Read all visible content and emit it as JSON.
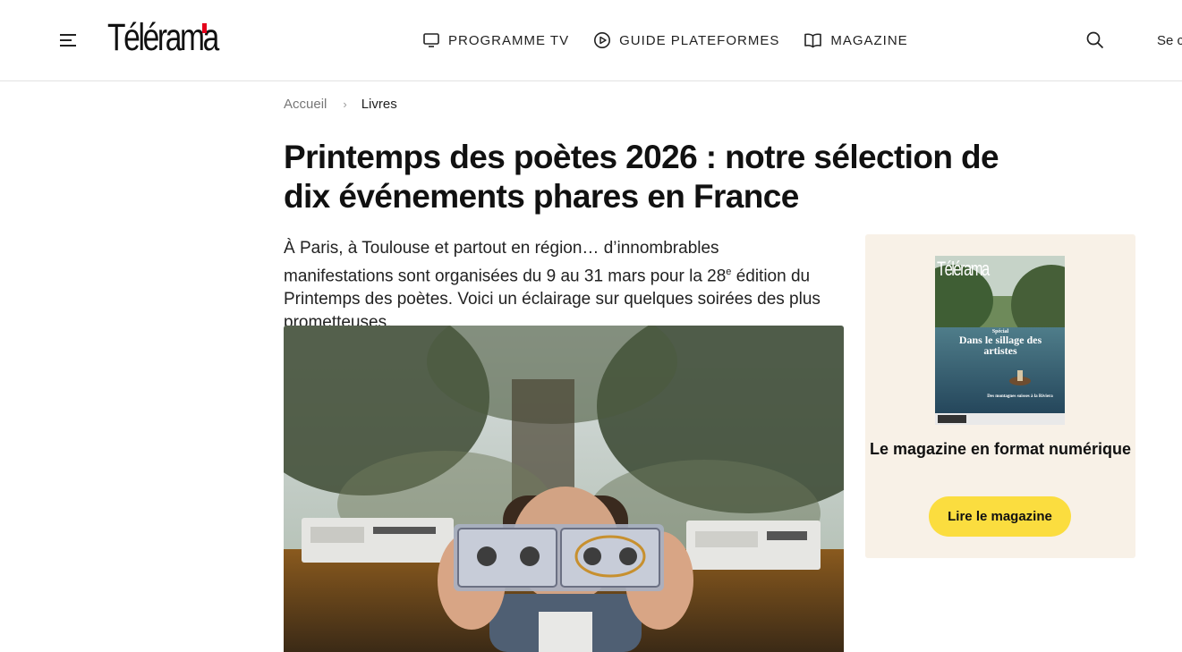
{
  "header": {
    "logo_text": "Télérama",
    "menu_icon": "hamburger-menu-icon",
    "nav": [
      {
        "label": "PROGRAMME TV",
        "icon": "tv-icon"
      },
      {
        "label": "GUIDE PLATEFORMES",
        "icon": "play-circle-icon"
      },
      {
        "label": "MAGAZINE",
        "icon": "open-book-icon"
      }
    ],
    "search_icon": "search-icon",
    "login_label": "Se connecter"
  },
  "breadcrumb": {
    "home": "Accueil",
    "current": "Livres"
  },
  "article": {
    "title": "Printemps des poètes 2026 : notre sélection de dix événements phares en France",
    "lead_part1": "À Paris, à Toulouse et partout en région… d’innombrables manifestations sont organisées du 9 au 31 mars pour la 28",
    "lead_sup": "e",
    "lead_part2": " édition du Printemps des poètes. Voici un éclairage sur quelques soirées des plus prometteuses."
  },
  "promo": {
    "cover_logo": "Télérama",
    "cover_headline": "Dans le sillage des artistes",
    "cover_kicker": "Spécial",
    "cover_subline": "Des montagnes suisses à la Riviera",
    "title": "Le magazine en format numérique",
    "button_label": "Lire le magazine"
  },
  "colors": {
    "brand_red": "#e4001b",
    "promo_bg": "#f8f1e7",
    "button_yellow": "#fbdd3f"
  }
}
